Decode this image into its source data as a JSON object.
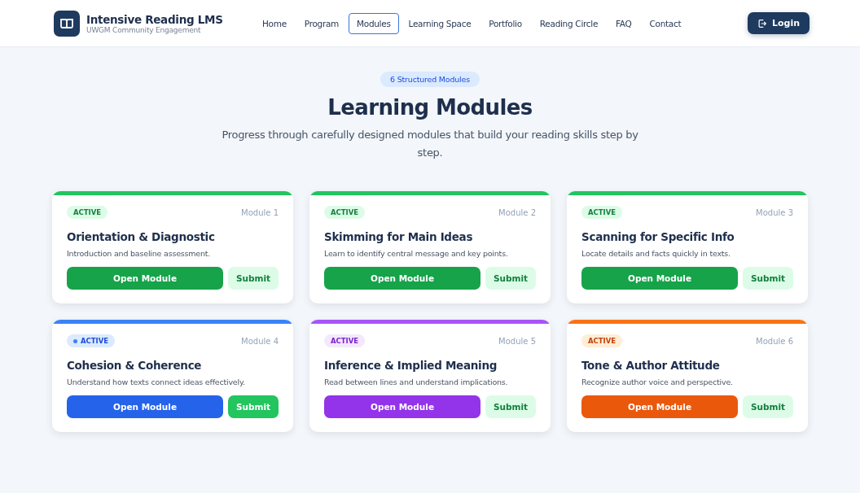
{
  "brand": {
    "title": "Intensive Reading LMS",
    "subtitle": "UWGM Community Engagement"
  },
  "nav": [
    {
      "label": "Home",
      "selected": false
    },
    {
      "label": "Program",
      "selected": false
    },
    {
      "label": "Modules",
      "selected": true
    },
    {
      "label": "Learning Space",
      "selected": false
    },
    {
      "label": "Portfolio",
      "selected": false
    },
    {
      "label": "Reading Circle",
      "selected": false
    },
    {
      "label": "FAQ",
      "selected": false
    },
    {
      "label": "Contact",
      "selected": false
    }
  ],
  "login_button": "Login",
  "hero": {
    "badge": "6 Structured Modules",
    "title": "Learning Modules",
    "subtitle": "Progress through carefully designed modules that build your reading skills step by step."
  },
  "modules": [
    {
      "status": "ACTIVE",
      "status_dot": false,
      "number": "Module 1",
      "title": "Orientation & Diagnostic",
      "description": "Introduction and baseline assessment.",
      "color": "#22c55e",
      "open_button": "Open Module",
      "submit": {
        "label": "Submit",
        "kind": "soft"
      }
    },
    {
      "status": "ACTIVE",
      "status_dot": false,
      "number": "Module 2",
      "title": "Skimming for Main Ideas",
      "description": "Learn to identify central message and key points.",
      "color": "#22c55e",
      "open_button": "Open Module",
      "submit": {
        "label": "Submit",
        "kind": "soft"
      }
    },
    {
      "status": "ACTIVE",
      "status_dot": false,
      "number": "Module 3",
      "title": "Scanning for Specific Info",
      "description": "Locate details and facts quickly in texts.",
      "color": "#22c55e",
      "open_button": "Open Module",
      "submit": {
        "label": "Submit",
        "kind": "soft"
      }
    },
    {
      "status": "ACTIVE",
      "status_dot": true,
      "number": "Module 4",
      "title": "Cohesion & Coherence",
      "description": "Understand how texts connect ideas effectively.",
      "color": "#3b82f6",
      "open_button": "Open Module",
      "submit": {
        "label": "Submit",
        "kind": "solid"
      }
    },
    {
      "status": "ACTIVE",
      "status_dot": false,
      "number": "Module 5",
      "title": "Inference & Implied Meaning",
      "description": "Read between lines and understand implications.",
      "color": "#a855f7",
      "open_button": "Open Module",
      "submit": {
        "label": "Submit",
        "kind": "soft"
      }
    },
    {
      "status": "ACTIVE",
      "status_dot": false,
      "number": "Module 6",
      "title": "Tone & Author Attitude",
      "description": "Recognize author voice and perspective.",
      "color": "#f97316",
      "open_button": "Open Module",
      "submit": {
        "label": "Submit",
        "kind": "soft"
      }
    }
  ]
}
